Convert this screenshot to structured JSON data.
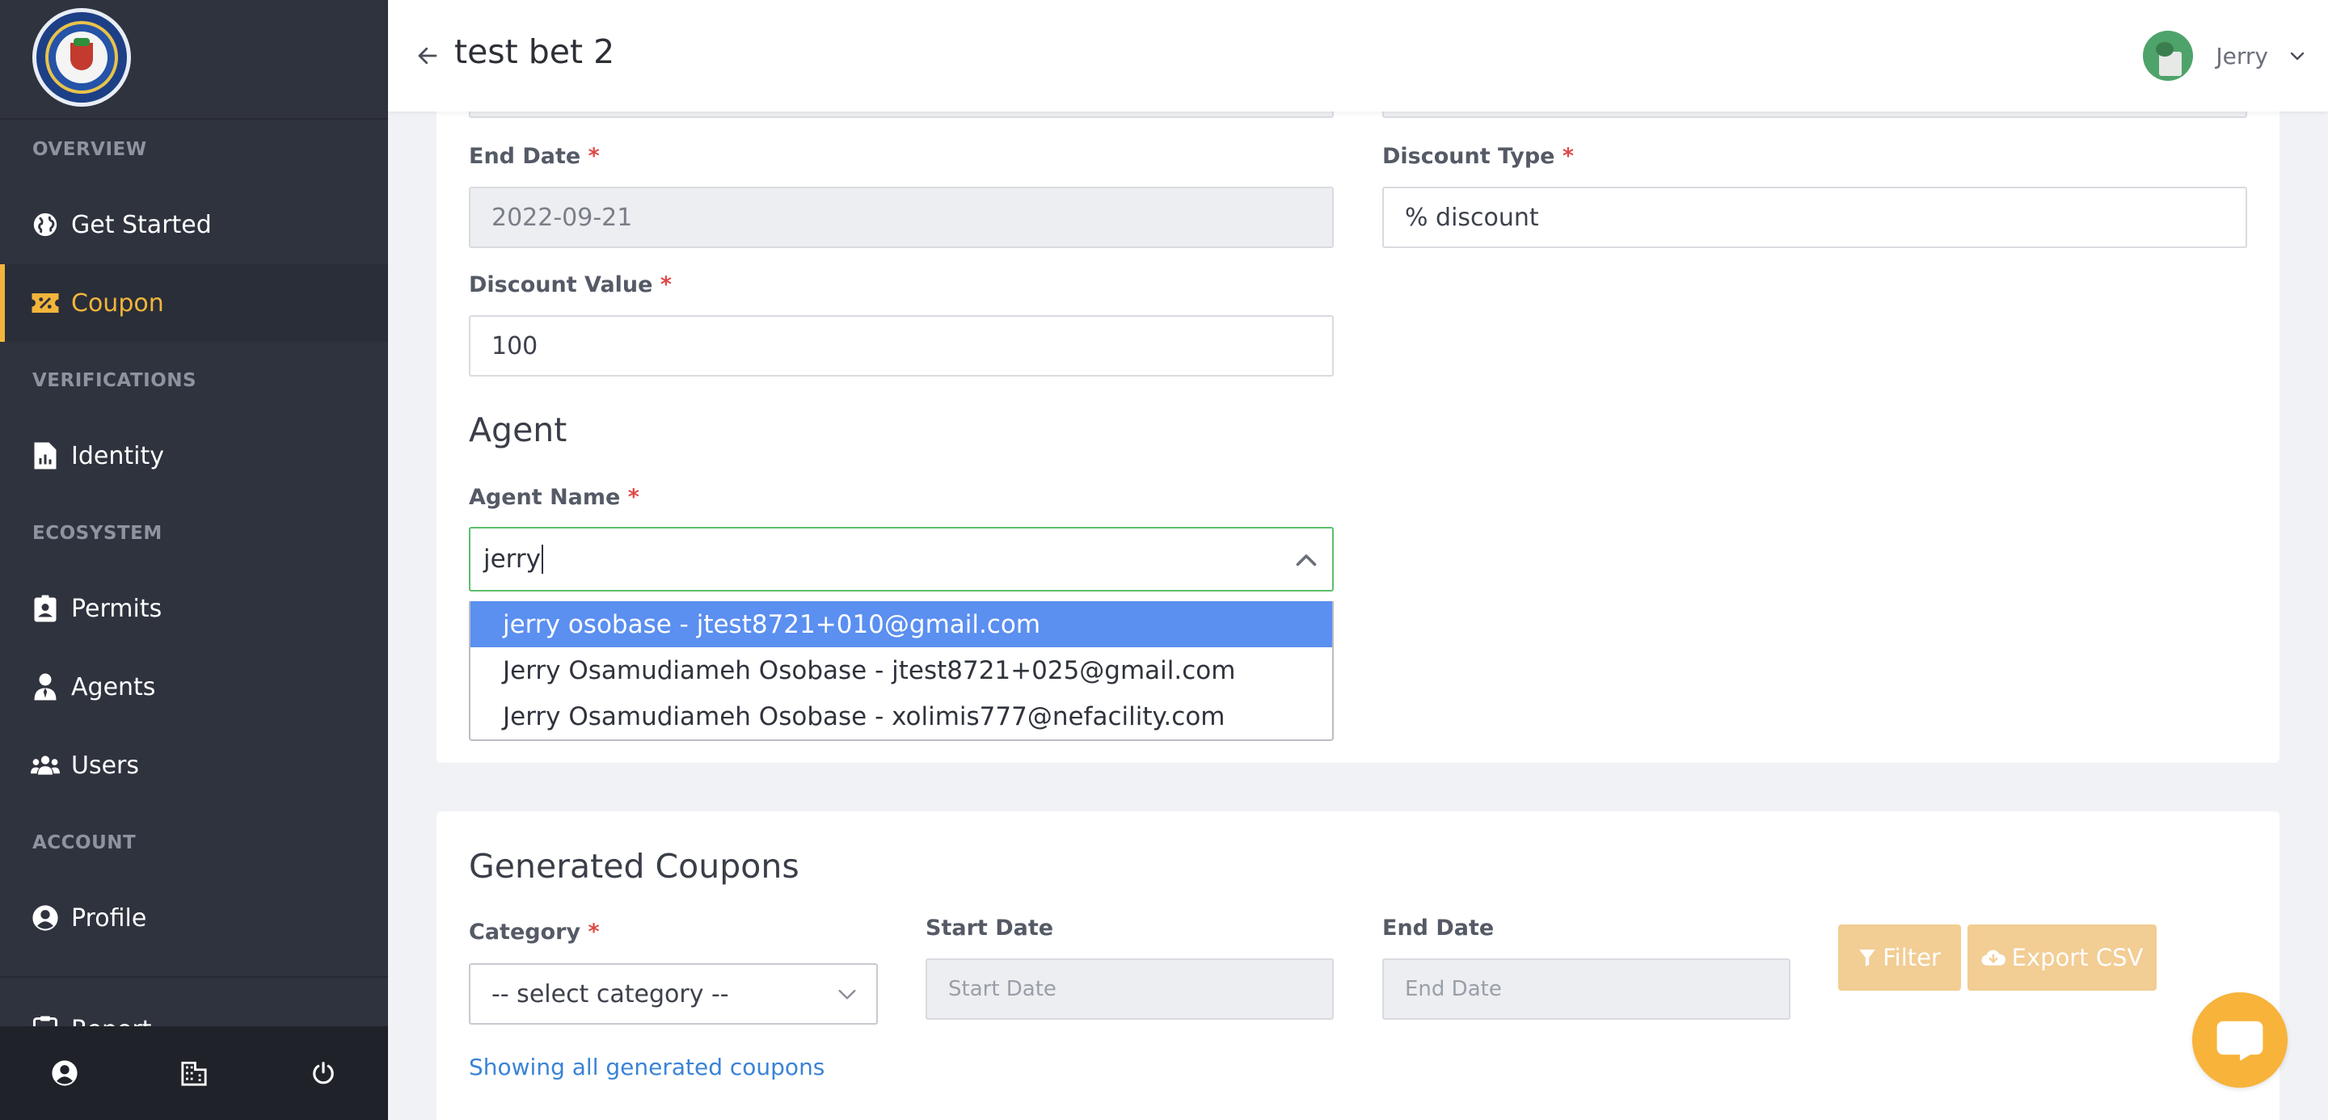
{
  "header": {
    "title": "test bet 2",
    "user_name": "Jerry"
  },
  "sidebar": {
    "sections": [
      {
        "label": "OVERVIEW"
      },
      {
        "label": "VERIFICATIONS"
      },
      {
        "label": "ECOSYSTEM"
      },
      {
        "label": "ACCOUNT"
      }
    ],
    "items": [
      {
        "label": "Get Started",
        "icon": "globe-icon"
      },
      {
        "label": "Coupon",
        "icon": "ticket-icon",
        "active": true
      },
      {
        "label": "Identity",
        "icon": "document-icon"
      },
      {
        "label": "Permits",
        "icon": "id-badge-icon"
      },
      {
        "label": "Agents",
        "icon": "person-tie-icon"
      },
      {
        "label": "Users",
        "icon": "users-icon"
      },
      {
        "label": "Profile",
        "icon": "user-circle-icon"
      },
      {
        "label": "Report",
        "icon": "clipboard-icon"
      }
    ],
    "bottom_icons": [
      "user-circle-icon",
      "building-icon",
      "power-icon"
    ],
    "accent_color": "#f2b53b",
    "background": "#2f333e"
  },
  "form": {
    "end_date": {
      "label": "End Date",
      "required": "*",
      "value": "2022-09-21"
    },
    "discount_type": {
      "label": "Discount Type",
      "required": "*",
      "value": "% discount"
    },
    "discount_value": {
      "label": "Discount Value",
      "required": "*",
      "value": "100"
    }
  },
  "agent": {
    "section_title": "Agent",
    "name_label": "Agent Name",
    "required": "*",
    "search_value": "jerry",
    "options": [
      "jerry osobase - jtest8721+010@gmail.com",
      "Jerry Osamudiameh Osobase - jtest8721+025@gmail.com",
      "Jerry Osamudiameh Osobase - xolimis777@nefacility.com"
    ],
    "highlight_color": "#5b8ff0"
  },
  "generated": {
    "title": "Generated Coupons",
    "category_label": "Category",
    "required": "*",
    "category_value": "-- select category --",
    "start_date_label": "Start Date",
    "start_date_placeholder": "Start Date",
    "end_date_label": "End Date",
    "end_date_placeholder": "End Date",
    "filter_label": "Filter",
    "export_label": "Export CSV",
    "showing_text": "Showing all generated coupons",
    "button_color": "#f2cd94",
    "link_color": "#3a83d6"
  },
  "chat": {
    "icon": "chat-bubble-icon",
    "color": "#f7b33a"
  }
}
